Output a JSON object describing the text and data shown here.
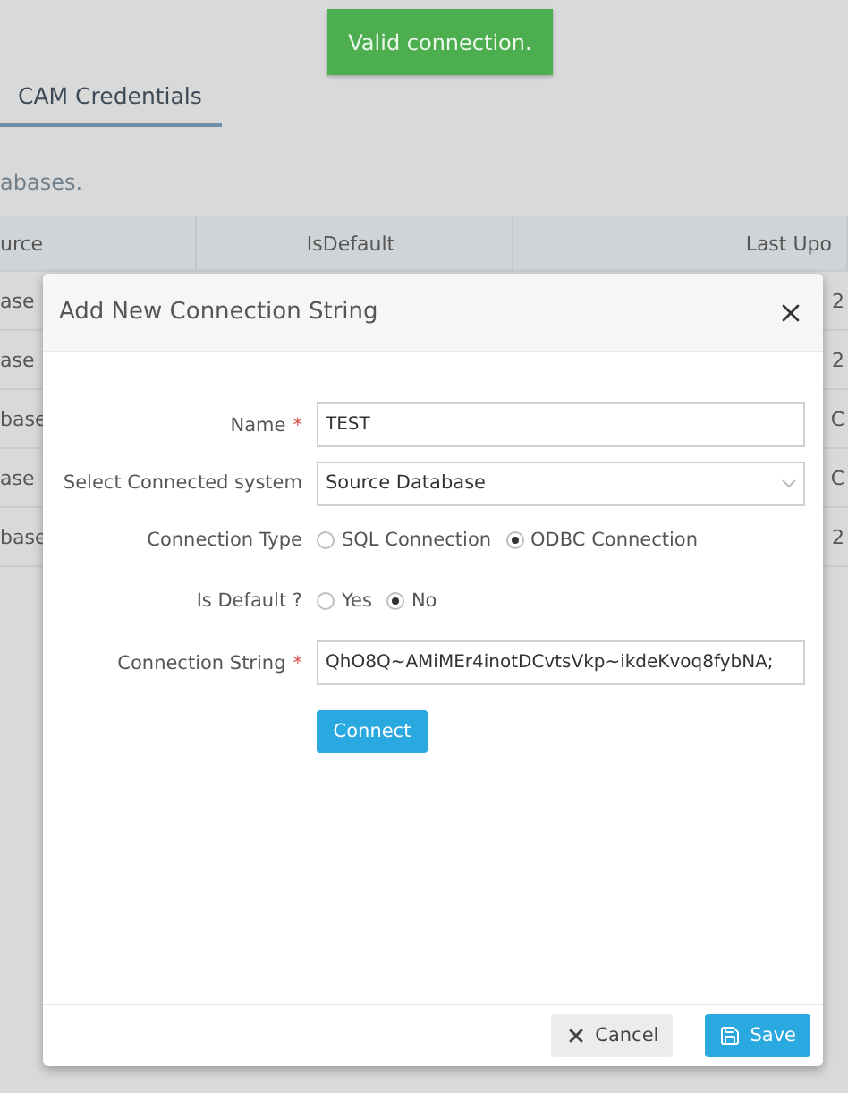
{
  "toast": {
    "text": "Valid connection."
  },
  "tabs": [
    {
      "label": "CAM Credentials",
      "selected": true
    }
  ],
  "description": "abases.",
  "table": {
    "columns": [
      "urce",
      "IsDefault",
      "Last Upo"
    ],
    "rows": [
      {
        "cells": [
          "ase",
          "",
          "2"
        ]
      },
      {
        "cells": [
          "ase",
          "",
          "2"
        ]
      },
      {
        "cells": [
          "base",
          "",
          "C"
        ]
      },
      {
        "cells": [
          "ase",
          "",
          "C"
        ]
      },
      {
        "cells": [
          "base",
          "",
          "2"
        ]
      }
    ]
  },
  "dialog": {
    "title": "Add New Connection String",
    "fields": [
      {
        "kind": "text",
        "label": "Name",
        "required_mark": "*",
        "value": "TEST"
      },
      {
        "kind": "select",
        "label": "Select Connected system",
        "value": "Source Database"
      },
      {
        "kind": "radio",
        "label": "Connection Type",
        "options": [
          {
            "label": "SQL Connection",
            "selected": false
          },
          {
            "label": "ODBC Connection",
            "selected": true
          }
        ]
      },
      {
        "kind": "radio",
        "label": "Is Default ?",
        "options": [
          {
            "label": "Yes",
            "selected": false
          },
          {
            "label": "No",
            "selected": true
          }
        ]
      },
      {
        "kind": "text",
        "label": "Connection String",
        "required_mark": "*",
        "value": "QhO8Q~AMiMEr4inotDCvtsVkp~ikdeKvoq8fybNA;"
      }
    ],
    "connect_button": "Connect",
    "buttons": [
      {
        "kind": "cancel",
        "label": "Cancel"
      },
      {
        "kind": "save",
        "label": "Save"
      }
    ]
  }
}
